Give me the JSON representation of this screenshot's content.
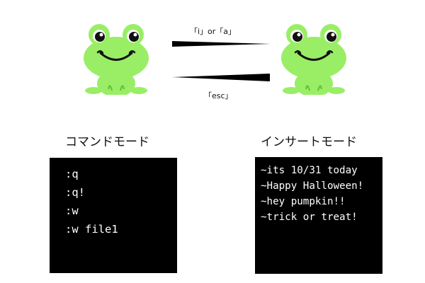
{
  "transitions": {
    "to_insert_label": "「i」or「a」",
    "to_command_label": "「esc」"
  },
  "modes": {
    "command": {
      "title": "コマンドモード",
      "lines": [
        ":q",
        ":q!",
        ":w",
        ":w file1"
      ]
    },
    "insert": {
      "title": "インサートモード",
      "lines": [
        "~its 10/31 today",
        "~Happy Halloween!",
        "~hey pumpkin!!",
        "~trick or treat!"
      ]
    }
  },
  "colors": {
    "frog_body": "#99ee66",
    "terminal_bg": "#000000",
    "terminal_text": "#ffffff"
  },
  "icons": [
    "frog-icon",
    "frog-icon"
  ]
}
